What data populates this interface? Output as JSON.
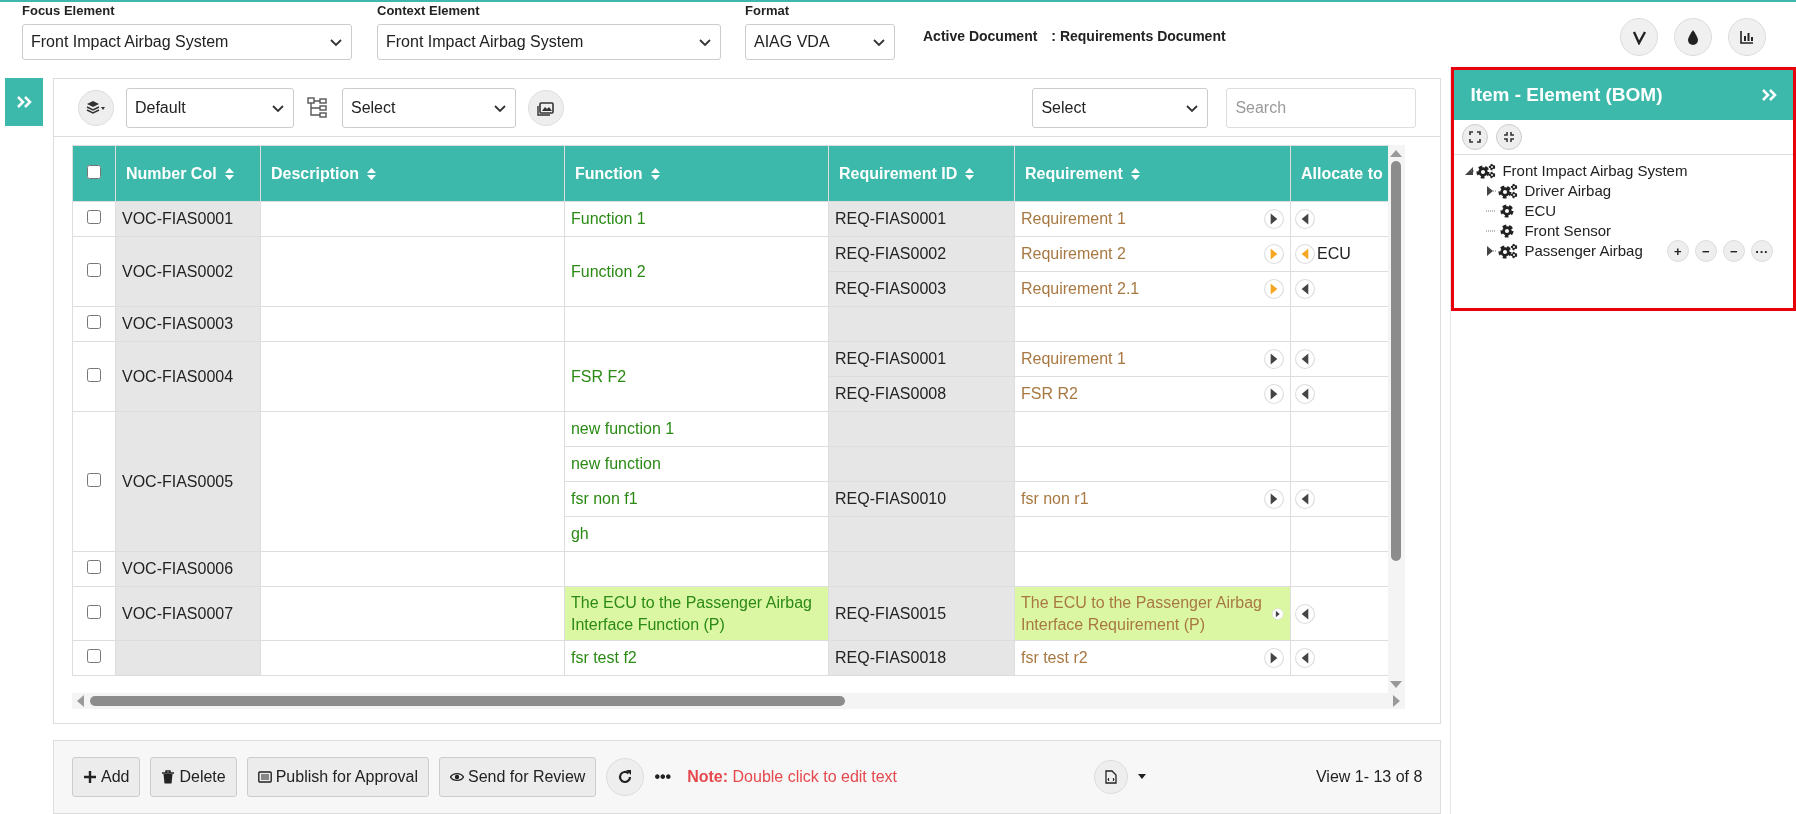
{
  "header": {
    "fields": [
      {
        "label": "Focus Element",
        "value": "Front Impact Airbag System"
      },
      {
        "label": "Context Element",
        "value": "Front Impact Airbag System"
      },
      {
        "label": "Format",
        "value": "AIAG VDA"
      }
    ],
    "active_document": {
      "label": "Active Document",
      "value": ": Requirements Document"
    }
  },
  "toolbar": {
    "view_select": "Default",
    "group_select": "Select",
    "filter_select": "Select",
    "search": {
      "placeholder": "Search"
    }
  },
  "table": {
    "select_all_checked": false,
    "columns": [
      "Number Col",
      "Description",
      "Function",
      "Requirement ID",
      "Requirement",
      "Allocate to"
    ],
    "rows": [
      {
        "number": "VOC-FIAS0001",
        "checked": false,
        "functions": [
          {
            "name": "Function 1",
            "highlighted": false,
            "requirements": [
              {
                "id": "REQ-FIAS0001",
                "text": "Requirement 1",
                "highlighted": false,
                "linked": false,
                "allocate_linked": false
              }
            ]
          }
        ]
      },
      {
        "number": "VOC-FIAS0002",
        "checked": false,
        "functions": [
          {
            "name": "Function 2",
            "highlighted": false,
            "requirements": [
              {
                "id": "REQ-FIAS0002",
                "text": "Requirement 2",
                "highlighted": false,
                "linked": true,
                "allocate_linked": true,
                "allocate": "ECU"
              },
              {
                "id": "REQ-FIAS0003",
                "text": "Requirement 2.1",
                "highlighted": false,
                "linked": true,
                "allocate_linked": false
              }
            ]
          }
        ]
      },
      {
        "number": "VOC-FIAS0003",
        "checked": false,
        "functions": []
      },
      {
        "number": "VOC-FIAS0004",
        "checked": false,
        "functions": [
          {
            "name": "FSR F2",
            "highlighted": false,
            "requirements": [
              {
                "id": "REQ-FIAS0001",
                "text": "Requirement 1",
                "highlighted": false,
                "linked": false,
                "allocate_linked": false
              },
              {
                "id": "REQ-FIAS0008",
                "text": "FSR R2",
                "highlighted": false,
                "linked": false,
                "allocate_linked": false
              }
            ]
          }
        ]
      },
      {
        "number": "VOC-FIAS0005",
        "checked": false,
        "functions": [
          {
            "name": "new function 1",
            "highlighted": false
          },
          {
            "name": "new function",
            "highlighted": false
          },
          {
            "name": "fsr non f1",
            "highlighted": false,
            "requirements": [
              {
                "id": "REQ-FIAS0010",
                "text": "fsr non r1",
                "highlighted": false,
                "linked": false,
                "allocate_linked": false
              }
            ]
          },
          {
            "name": "gh",
            "highlighted": false
          }
        ]
      },
      {
        "number": "VOC-FIAS0006",
        "checked": false,
        "functions": []
      },
      {
        "number": "VOC-FIAS0007",
        "checked": false,
        "functions": [
          {
            "name": "The ECU to the Passenger Airbag Interface Function (P)",
            "highlighted": true,
            "requirements": [
              {
                "id": "REQ-FIAS0015",
                "text": "The ECU to the Passenger Airbag Interface Requirement (P)",
                "highlighted": true,
                "linked": false,
                "allocate_linked": false
              }
            ]
          }
        ]
      },
      {
        "checked": false,
        "functions": [
          {
            "name": "fsr test f2",
            "highlighted": false,
            "requirements": [
              {
                "id": "REQ-FIAS0018",
                "text": "fsr test r2",
                "highlighted": false,
                "linked": false,
                "allocate_linked": false
              }
            ]
          }
        ]
      }
    ]
  },
  "footer": {
    "buttons": [
      "Add",
      "Delete",
      "Publish for Approval",
      "Send for Review"
    ],
    "more": "•••",
    "note": "**Note:** Double click to edit text",
    "pager": "View 1- 13 of 8"
  },
  "side_panel": {
    "title": "Item - Element (BOM)",
    "tree": [
      {
        "label": "Front Impact Airbag System",
        "kind": "assembly",
        "expanded": true,
        "children": [
          {
            "label": "Driver Airbag",
            "kind": "assembly",
            "expanded": false
          },
          {
            "label": "ECU",
            "kind": "part"
          },
          {
            "label": "Front Sensor",
            "kind": "part"
          },
          {
            "label": "Passenger Airbag",
            "kind": "assembly",
            "expanded": false,
            "actions": [
              "+",
              "−",
              "−",
              "···"
            ]
          }
        ]
      }
    ]
  }
}
